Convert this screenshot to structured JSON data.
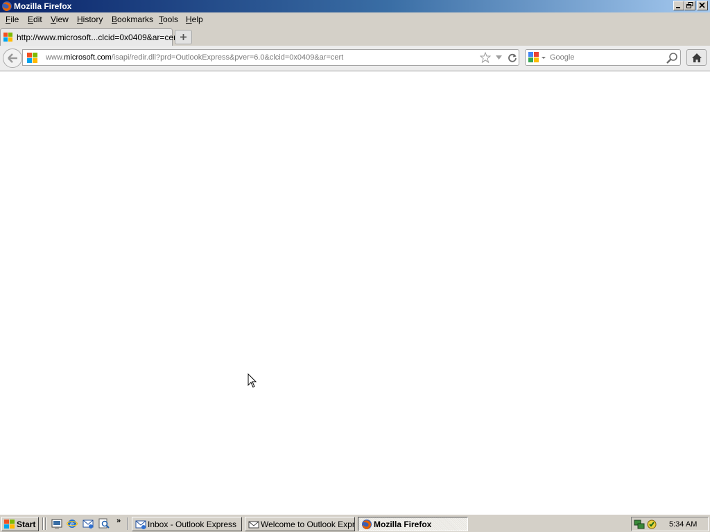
{
  "window": {
    "title": "Mozilla Firefox"
  },
  "menu": {
    "items": [
      {
        "accel": "F",
        "rest": "ile"
      },
      {
        "accel": "E",
        "rest": "dit"
      },
      {
        "accel": "V",
        "rest": "iew"
      },
      {
        "accel": "H",
        "rest": "istory"
      },
      {
        "accel": "B",
        "rest": "ookmarks"
      },
      {
        "accel": "T",
        "rest": "ools"
      },
      {
        "accel": "H",
        "rest": "elp"
      }
    ]
  },
  "tab": {
    "title": "http://www.microsoft...clcid=0x0409&ar=cert",
    "new_tab_label": "+"
  },
  "address": {
    "prefix": "www.",
    "host": "microsoft.com",
    "path": "/isapi/redir.dll?prd=OutlookExpress&pver=6.0&clcid=0x0409&ar=cert"
  },
  "search": {
    "placeholder": "Google"
  },
  "taskbar": {
    "start_label": "Start",
    "chevron": "»",
    "buttons": [
      {
        "label": "Inbox - Outlook Express"
      },
      {
        "label": "Welcome to Outlook Expr..."
      },
      {
        "label": "Mozilla Firefox"
      }
    ],
    "clock": "5:34 AM"
  },
  "icons": {
    "app": "firefox-icon",
    "site": "microsoft-logo-icon",
    "search_engine": "google-icon",
    "bookmark": "star-icon",
    "reload": "reload-icon",
    "home": "home-icon",
    "back": "back-arrow-icon",
    "search": "magnifier-icon"
  },
  "colors": {
    "title_bar": "#0a246a",
    "chrome": "#d4d0c8",
    "page_background": "#ffffff"
  }
}
